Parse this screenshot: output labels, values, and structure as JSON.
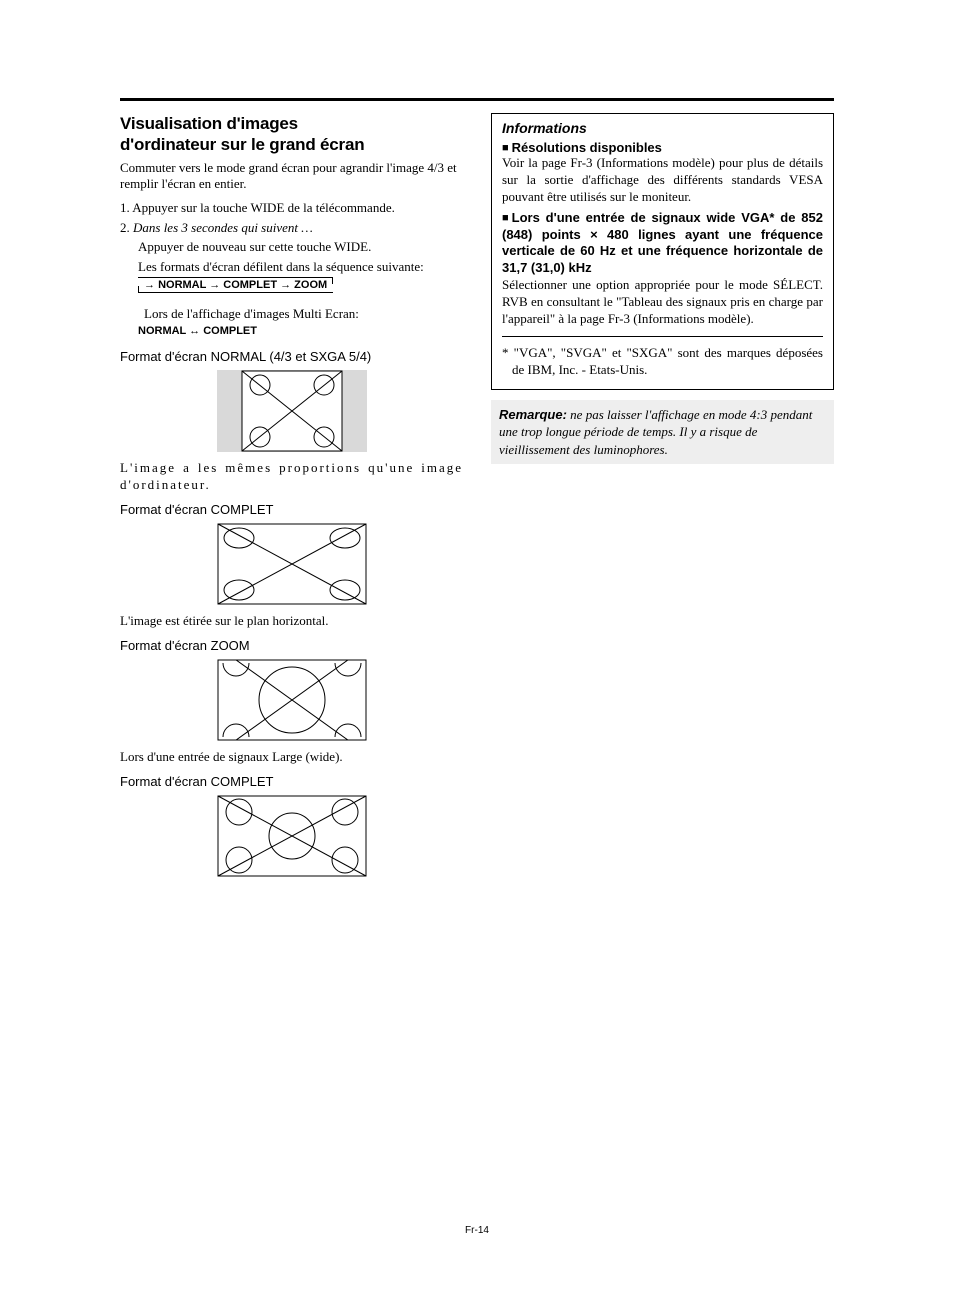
{
  "left": {
    "title_line1": "Visualisation d'images",
    "title_line2": "d'ordinateur sur le grand écran",
    "intro": "Commuter vers le mode grand écran pour agrandir l'image 4/3 et remplir l'écran en entier.",
    "step1": "1. Appuyer sur la touche WIDE de la télécommande.",
    "step2_lead": "2.",
    "step2_italic": "Dans les 3 secondes qui suivent …",
    "step2_line2": "Appuyer de nouveau sur cette touche WIDE.",
    "step2_line3": "Les formats d'écran défilent dans la séquence suivante:",
    "seq": {
      "a": "NORMAL",
      "b": "COMPLET",
      "c": "ZOOM"
    },
    "multi_line": "Lors de l'affichage d'images Multi Ecran:",
    "seq2": {
      "a": "NORMAL",
      "b": "COMPLET"
    },
    "fmt_normal_h": "Format d'écran NORMAL (4/3 et SXGA 5/4)",
    "fmt_normal_p": "L'image a les mêmes proportions qu'une image d'ordinateur.",
    "fmt_complet_h": "Format d'écran COMPLET",
    "fmt_complet_p": "L'image est étirée sur le plan horizontal.",
    "fmt_zoom_h": "Format d'écran ZOOM",
    "fmt_zoom_p": "Lors d'une entrée de signaux Large (wide).",
    "fmt_complet2_h": "Format d'écran COMPLET"
  },
  "right": {
    "info_title": "Informations",
    "res_h": "Résolutions disponibles",
    "res_p": "Voir la page Fr-3 (Informations modèle) pour plus de détails sur la sortie d'affichage des différents standards VESA pouvant être utilisés sur le moniteur.",
    "vga_h": "Lors d'une entrée de signaux wide VGA* de 852 (848) points × 480 lignes ayant une fréquence verticale de 60 Hz et une fréquence horizontale de 31,7 (31,0) kHz",
    "vga_p": "Sélectionner une option appropriée pour le mode SÉLECT. RVB en consultant le \"Tableau des signaux pris en charge par l'appareil\" à la page Fr-3 (Informations modèle).",
    "foot": "* \"VGA\", \"SVGA\" et \"SXGA\" sont des marques déposées de IBM, Inc. - Etats-Unis.",
    "note_lead": "Remarque:",
    "note_body": "ne pas laisser l'affichage en mode 4:3 pendant une trop longue période de temps. Il y a risque de vieillissement des luminophores."
  },
  "footer": "Fr-14"
}
